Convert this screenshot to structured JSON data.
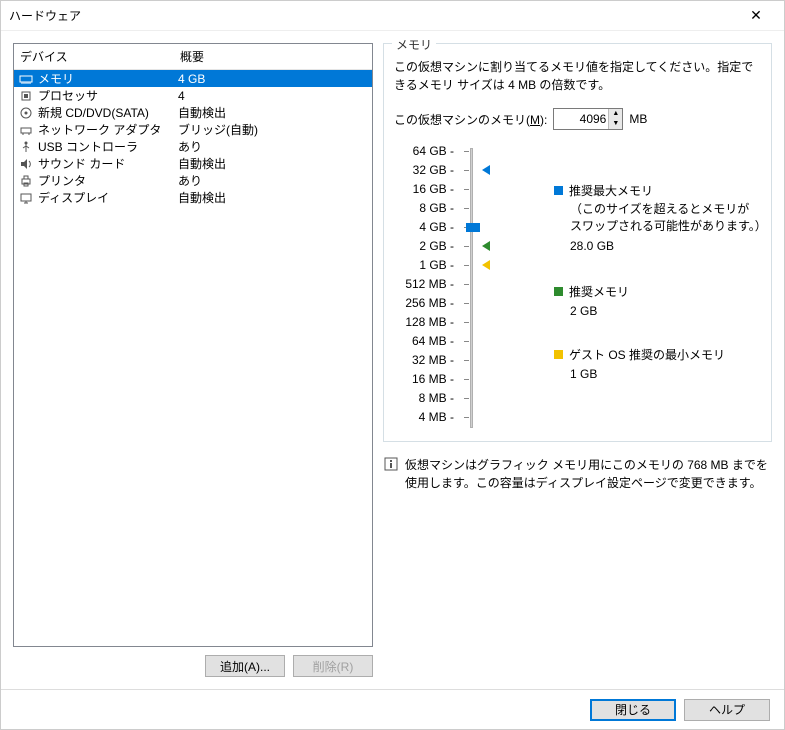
{
  "window": {
    "title": "ハードウェア"
  },
  "columns": {
    "device": "デバイス",
    "summary": "概要"
  },
  "devices": [
    {
      "icon": "memory-icon",
      "name": "メモリ",
      "summary": "4 GB",
      "selected": true
    },
    {
      "icon": "cpu-icon",
      "name": "プロセッサ",
      "summary": "4"
    },
    {
      "icon": "cd-icon",
      "name": "新規 CD/DVD(SATA)",
      "summary": "自動検出"
    },
    {
      "icon": "network-icon",
      "name": "ネットワーク アダプタ",
      "summary": "ブリッジ(自動)"
    },
    {
      "icon": "usb-icon",
      "name": "USB コントローラ",
      "summary": "あり"
    },
    {
      "icon": "sound-icon",
      "name": "サウンド カード",
      "summary": "自動検出"
    },
    {
      "icon": "printer-icon",
      "name": "プリンタ",
      "summary": "あり"
    },
    {
      "icon": "display-icon",
      "name": "ディスプレイ",
      "summary": "自動検出"
    }
  ],
  "buttons": {
    "add": "追加(A)...",
    "remove": "削除(R)",
    "close": "閉じる",
    "help": "ヘルプ"
  },
  "memory": {
    "group_title": "メモリ",
    "description": "この仮想マシンに割り当てるメモリ値を指定してください。指定できるメモリ サイズは 4 MB の倍数です。",
    "label_prefix": "この仮想マシンのメモリ(",
    "label_key": "M",
    "label_suffix": "):",
    "value": "4096",
    "unit": "MB",
    "ticks": [
      "64 GB",
      "32 GB",
      "16 GB",
      "8 GB",
      "4 GB",
      "2 GB",
      "1 GB",
      "512 MB",
      "256 MB",
      "128 MB",
      "64 MB",
      "32 MB",
      "16 MB",
      "8 MB",
      "4 MB"
    ],
    "current_index": 4,
    "markers": [
      {
        "index": 1,
        "color": "#0078d7"
      },
      {
        "index": 5,
        "color": "#2e8b2e"
      },
      {
        "index": 6,
        "color": "#f2c200"
      }
    ],
    "legend": [
      {
        "color": "#0078d7",
        "label": "推奨最大メモリ",
        "sub": "（このサイズを超えるとメモリがスワップされる可能性があります。）",
        "value": "28.0 GB"
      },
      {
        "color": "#2e8b2e",
        "label": "推奨メモリ",
        "sub": "",
        "value": "2 GB"
      },
      {
        "color": "#f2c200",
        "label": "ゲスト OS 推奨の最小メモリ",
        "sub": "",
        "value": "1 GB"
      }
    ],
    "info": "仮想マシンはグラフィック メモリ用にこのメモリの 768 MB までを使用します。この容量はディスプレイ設定ページで変更できます。"
  }
}
